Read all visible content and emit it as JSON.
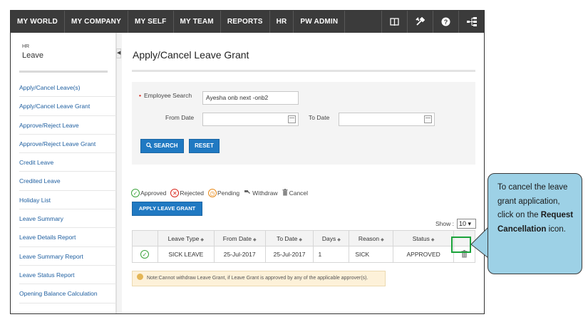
{
  "nav": {
    "items": [
      "MY WORLD",
      "MY COMPANY",
      "MY SELF",
      "MY TEAM",
      "REPORTS",
      "HR",
      "PW ADMIN"
    ],
    "icons": [
      "book-icon",
      "tools-icon",
      "help-icon",
      "sitemap-icon"
    ]
  },
  "sidebar": {
    "module": "HR",
    "title": "Leave",
    "items": [
      "Apply/Cancel Leave(s)",
      "Apply/Cancel Leave Grant",
      "Approve/Reject Leave",
      "Approve/Reject Leave Grant",
      "Credit Leave",
      "Credited Leave",
      "Holiday List",
      "Leave Summary",
      "Leave Details Report",
      "Leave Summary Report",
      "Leave Status Report",
      "Opening Balance Calculation"
    ]
  },
  "page": {
    "title": "Apply/Cancel Leave Grant"
  },
  "form": {
    "employee_label": "Employee Search",
    "employee_value": "Ayesha onb next  -onb2",
    "from_label": "From Date",
    "to_label": "To Date",
    "from_value": "",
    "to_value": "",
    "search_label": "SEARCH",
    "reset_label": "RESET"
  },
  "legend": {
    "approved": "Approved",
    "rejected": "Rejected",
    "pending": "Pending",
    "withdraw": "Withdraw",
    "cancel": "Cancel"
  },
  "apply_button": "APPLY LEAVE GRANT",
  "show": {
    "label": "Show :",
    "value": "10 ▾"
  },
  "table": {
    "headers": [
      "Leave Type",
      "From Date",
      "To Date",
      "Days",
      "Reason",
      "Status"
    ],
    "rows": [
      {
        "leave_type": "SICK LEAVE",
        "from": "25-Jul-2017",
        "to": "25-Jul-2017",
        "days": "1",
        "reason": "SICK",
        "status": "APPROVED"
      }
    ]
  },
  "note": "Note:Cannot withdraw Leave Grant, if Leave Grant is approved by any of the applicable approver(s).",
  "callout": {
    "line1": "To cancel the leave grant application, click on the",
    "bold": "Request Cancellation",
    "line2": " icon."
  },
  "colors": {
    "nav_bg": "#3b3b3b",
    "accent": "#2079c2",
    "approved": "#3aa33a",
    "rejected": "#d9261c",
    "pending": "#e88a1a",
    "callout_bg": "#9dd1e6"
  }
}
